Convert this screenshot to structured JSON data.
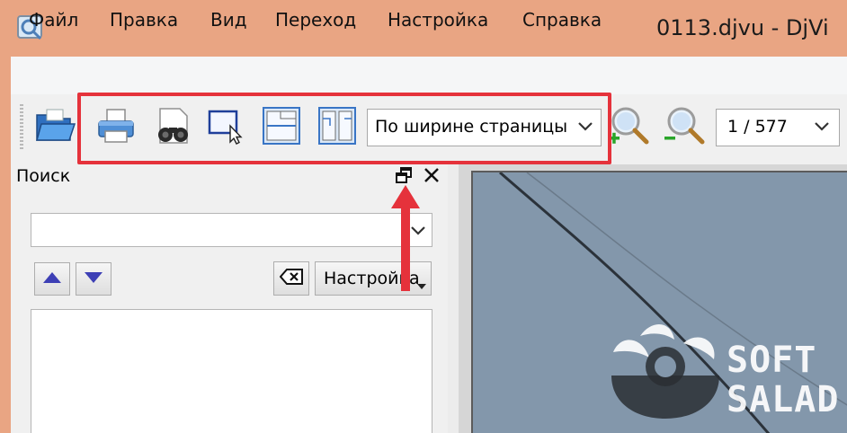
{
  "window": {
    "title": "0113.djvu - DjVi",
    "titlebar_color": "#e9a583"
  },
  "menu": {
    "items": [
      "Файл",
      "Правка",
      "Вид",
      "Переход",
      "Настройка",
      "Справка"
    ]
  },
  "toolbar": {
    "icons": [
      "open-folder-icon",
      "print-icon",
      "find-binoculars-icon",
      "select-region-icon",
      "single-page-icon",
      "two-page-icon",
      "zoom-in-icon",
      "zoom-out-icon"
    ],
    "zoom_mode": "По ширине страницы",
    "page_indicator": "1 / 577",
    "highlight_color": "#e5323b"
  },
  "search_panel": {
    "title": "Поиск",
    "query_value": "",
    "settings_label": "Настройка"
  },
  "watermark": {
    "line1": "SOFT",
    "line2": "SALAD"
  },
  "colors": {
    "document_page": "#8397ab",
    "annotation_arrow": "#e5323b"
  }
}
